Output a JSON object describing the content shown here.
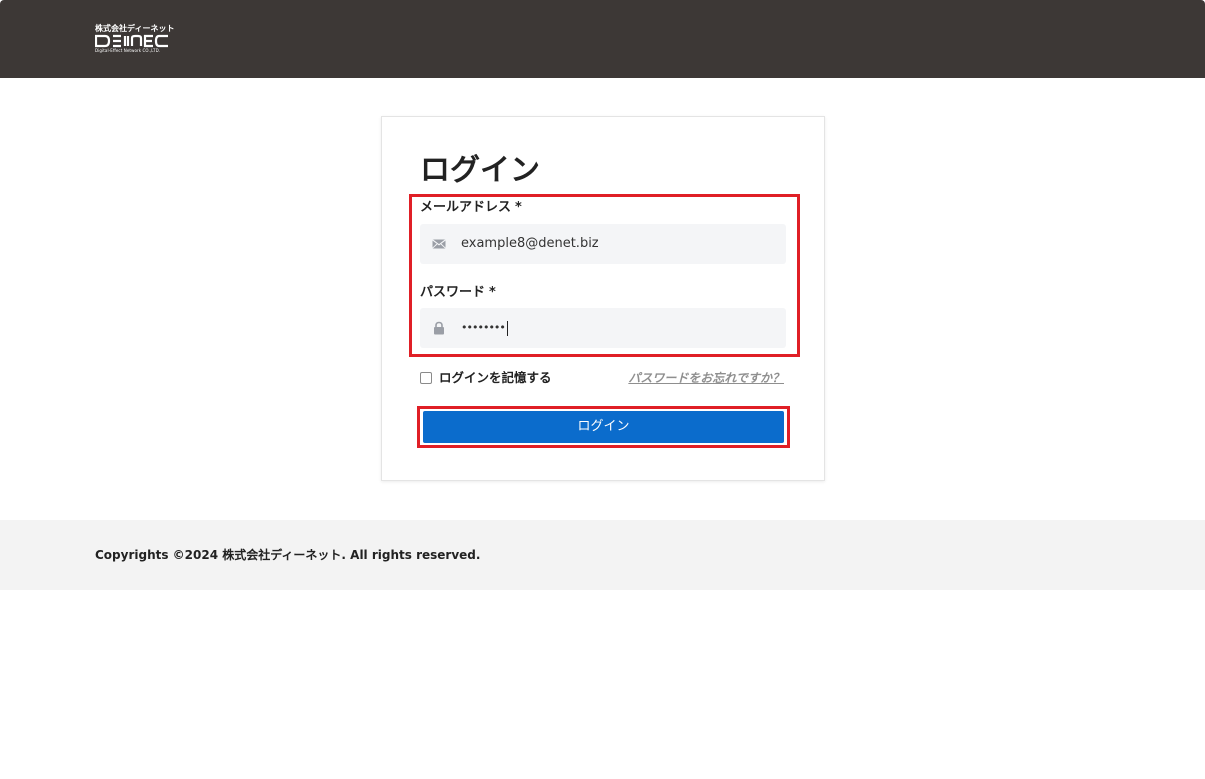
{
  "header": {
    "logo": {
      "company_name": "株式会社ディーネット",
      "mark_text": "Denet",
      "subtitle": "Digital-Effect Network CO.,LTD."
    }
  },
  "login_form": {
    "title": "ログイン",
    "email": {
      "label": "メールアドレス",
      "required_mark": "*",
      "value": "example8@denet.biz",
      "icon": "envelope-icon"
    },
    "password": {
      "label": "パスワード",
      "required_mark": "*",
      "value": "••••••••",
      "icon": "lock-icon"
    },
    "remember_label": "ログインを記憶する",
    "remember_checked": false,
    "forgot_link": "パスワードをお忘れですか？",
    "submit_label": "ログイン"
  },
  "footer": {
    "copyright": "Copyrights ©2024 株式会社ディーネット. All rights reserved."
  },
  "colors": {
    "header_bg": "#3d3836",
    "button_bg": "#0b6ccc",
    "highlight": "#e01f26",
    "footer_bg": "#f3f3f3"
  }
}
